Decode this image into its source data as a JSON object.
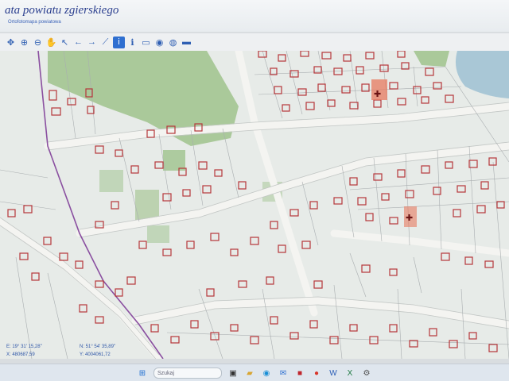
{
  "header": {
    "title": "ata powiatu zgierskiego",
    "subtitle": "Ortofotomapa powiatowa"
  },
  "toolbar": {
    "icons": [
      "pan-icon",
      "zoom-in-icon",
      "zoom-out-icon",
      "hand-icon",
      "select-icon",
      "back-icon",
      "forward-icon",
      "measure-icon",
      "info-icon",
      "print-icon",
      "globe-icon",
      "help-icon",
      "more-icon"
    ]
  },
  "status": {
    "line1": "E: 19° 31' 15,28\"",
    "line2": "N: 51° 54' 35,89\"",
    "line3": "X: 480687,59",
    "line4": "Y: 4004061,72"
  },
  "colors": {
    "header_title": "#2b3f8f",
    "parcel_outline": "#b6363a",
    "greenery": "#9fc38c",
    "water": "#a9c7d6",
    "road": "#f4f4f1"
  },
  "taskbar": {
    "search_placeholder": "Szukaj"
  }
}
